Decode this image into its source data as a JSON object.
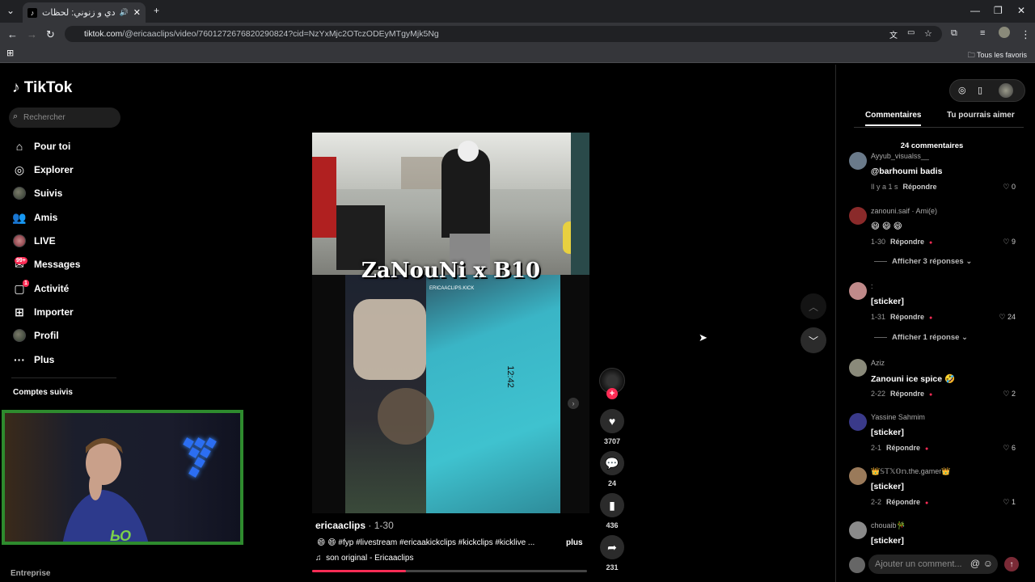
{
  "browser": {
    "tab_title": "رقلة من بادي و زنوني: لحظات",
    "url_domain": "tiktok.com",
    "url_path": "/@ericaaclips/video/7601272676820290824?cid=NzYxMjc2OTczODEyMTgyMjk5Ng",
    "bookmarks_label": "Tous les favoris"
  },
  "sidebar": {
    "logo": "TikTok",
    "search_placeholder": "Rechercher",
    "items": [
      {
        "label": "Pour toi"
      },
      {
        "label": "Explorer"
      },
      {
        "label": "Suivis"
      },
      {
        "label": "Amis"
      },
      {
        "label": "LIVE"
      },
      {
        "label": "Messages",
        "badge": "99+"
      },
      {
        "label": "Activité",
        "badge": "1"
      },
      {
        "label": "Importer"
      },
      {
        "label": "Profil"
      },
      {
        "label": "Plus"
      }
    ],
    "followed_title": "Comptes suivis",
    "footer": "Entreprise"
  },
  "video": {
    "overlay_title": "ZaNouNi x B10",
    "watermark": "ERICAACLIPS.KICK",
    "author": "ericaaclips",
    "date": "· 1-30",
    "caption": "😄 😄 #fyp #livestream #ericaakickclips #kickclips #kicklive ...",
    "more": "plus",
    "sound": "son original - Ericaaclips",
    "progress": 0.34
  },
  "actions": {
    "likes": "3707",
    "comments": "24",
    "saves": "436",
    "shares": "231"
  },
  "right_panel": {
    "tab_comments": "Commentaires",
    "tab_suggest": "Tu pourrais aimer",
    "count": "24 commentaires",
    "reply_label": "Répondre",
    "input_placeholder": "Ajouter un comment...",
    "comments": [
      {
        "name": "Ayyub_visualss__",
        "text": "@barhoumi badis",
        "time": "Il y a 1 s",
        "likes": "0"
      },
      {
        "name": "zanouni.saif · Ami(e)",
        "text": "😄 😄 😄",
        "time": "1-30",
        "likes": "9"
      },
      {
        "name": ":",
        "text": "[sticker]",
        "time": "1-31",
        "likes": "24"
      },
      {
        "name": "Aziz",
        "text": "Zanouni ice spice 🤣",
        "time": "2-22",
        "likes": "2"
      },
      {
        "name": "Yassine Sahmim",
        "text": "[sticker]",
        "time": "2-1",
        "likes": "6"
      },
      {
        "name": "👑𝕊𝕋𝕏𝕆𝕟.the.gamer👑",
        "text": "[sticker]",
        "time": "2-2",
        "likes": "1"
      },
      {
        "name": "chouaib🎋",
        "text": "[sticker]",
        "time": "",
        "likes": ""
      }
    ],
    "replies": [
      {
        "label": "Afficher 3 réponses"
      },
      {
        "label": "Afficher 1 réponse"
      }
    ]
  }
}
